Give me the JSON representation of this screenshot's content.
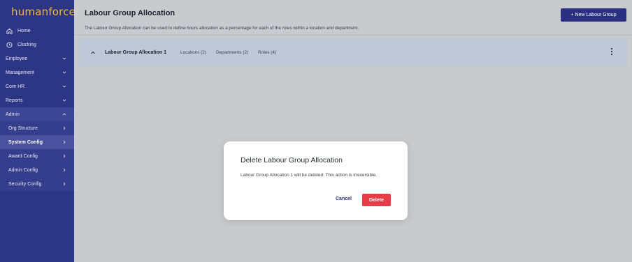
{
  "brand": {
    "logo_text": "humanforce",
    "accent": "#f5b731"
  },
  "sidebar": {
    "items": [
      {
        "label": "Home",
        "icon": "home-icon"
      },
      {
        "label": "Clocking",
        "icon": "clock-icon"
      },
      {
        "label": "Employee",
        "chevron": "chevron-down-icon"
      },
      {
        "label": "Management",
        "chevron": "chevron-down-icon"
      },
      {
        "label": "Core HR",
        "chevron": "chevron-down-icon"
      },
      {
        "label": "Reports",
        "chevron": "chevron-down-icon"
      },
      {
        "label": "Admin",
        "chevron": "chevron-up-icon"
      }
    ],
    "admin_subitems": [
      {
        "label": "Org Structure"
      },
      {
        "label": "System Config",
        "selected": true
      },
      {
        "label": "Award Config"
      },
      {
        "label": "Admin Config"
      },
      {
        "label": "Security Config"
      }
    ]
  },
  "header": {
    "title": "Labour Group Allocation",
    "description": "The Labour Group Allocation can be used to define hours allocation as a percentage for each of the roles within a location and department.",
    "new_button_label": "+ New Labour Group"
  },
  "group": {
    "name": "Labour Group Allocation 1",
    "locations": "Locations (2)",
    "departments": "Departments (2)",
    "roles": "Roles (4)"
  },
  "modal": {
    "title": "Delete Labour Group Allocation",
    "body": "Labour Group Allocation 1 will be deleted. This action is irreversible.",
    "cancel_label": "Cancel",
    "delete_label": "Delete"
  },
  "colors": {
    "sidebar_bg": "#2d3585",
    "primary_button": "#2a2f80",
    "danger": "#e83c47"
  }
}
